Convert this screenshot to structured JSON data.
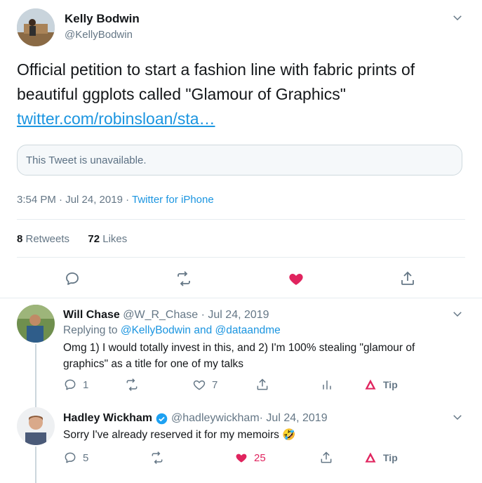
{
  "main_tweet": {
    "author_name": "Kelly Bodwin",
    "author_handle": "@KellyBodwin",
    "text": "Official petition to start a fashion line with fabric prints of beautiful ggplots called \"Glamour of Graphics\"",
    "link": "twitter.com/robinsloan/sta…",
    "quoted_unavailable": "This Tweet is unavailable.",
    "timestamp": "3:54 PM · Jul 24, 2019 · ",
    "source": "Twitter for iPhone",
    "retweets_count": "8",
    "retweets_label": " Retweets",
    "likes_count": "72",
    "likes_label": " Likes"
  },
  "replies": [
    {
      "author_name": "Will Chase",
      "author_handle": "@W_R_Chase",
      "date": " · Jul 24, 2019",
      "replying_to_prefix": "Replying to ",
      "replying_to_users": "@KellyBodwin and @dataandme",
      "text": "Omg 1) I would totally invest in this, and 2) I'm 100% stealing \"glamour of graphics\" as a title for one of my talks",
      "reply_count": "1",
      "retweet_count": "",
      "like_count": "7",
      "tip_label": "Tip",
      "liked": false
    },
    {
      "author_name": "Hadley Wickham",
      "author_handle": "@hadleywickham",
      "date": " · Jul 24, 2019",
      "verified": true,
      "text": "Sorry I've already reserved it for my memoirs 🤣",
      "reply_count": "5",
      "retweet_count": "",
      "like_count": "25",
      "tip_label": "Tip",
      "liked": true
    }
  ],
  "colors": {
    "link": "#1b95e0",
    "like_active": "#e0245e",
    "muted": "#657786",
    "divider": "#e6ecf0",
    "tip_accent": "#e0245e"
  }
}
